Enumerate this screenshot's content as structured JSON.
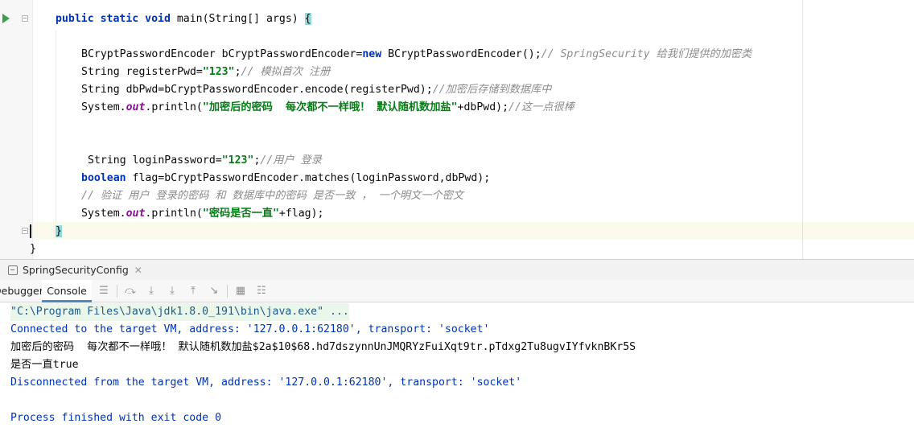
{
  "editor": {
    "lines": [
      {
        "parts": [
          {
            "t": "public static void ",
            "c": "kw"
          },
          {
            "t": "main(String[] args) "
          },
          {
            "t": "{",
            "c": "brace-hl"
          }
        ]
      },
      {
        "parts": [
          {
            "t": "BCryptPasswordEncoder bCryptPasswordEncoder="
          },
          {
            "t": "new",
            "c": "kw"
          },
          {
            "t": " BCryptPasswordEncoder();"
          },
          {
            "t": "// SpringSecurity 给我们提供的加密类",
            "c": "cmt"
          }
        ]
      },
      {
        "parts": [
          {
            "t": "String registerPwd="
          },
          {
            "t": "\"123\"",
            "c": "str"
          },
          {
            "t": ";"
          },
          {
            "t": "// 模拟首次 注册",
            "c": "cmt"
          }
        ]
      },
      {
        "parts": [
          {
            "t": "String dbPwd=bCryptPasswordEncoder.encode(registerPwd);"
          },
          {
            "t": "//加密后存储到数据库中",
            "c": "cmt"
          }
        ]
      },
      {
        "parts": [
          {
            "t": "System."
          },
          {
            "t": "out",
            "c": "fld"
          },
          {
            "t": ".println("
          },
          {
            "t": "\"加密后的密码  每次都不一样哦！ 默认随机数加盐\"",
            "c": "str"
          },
          {
            "t": "+dbPwd);"
          },
          {
            "t": "//这一点很棒",
            "c": "cmt"
          }
        ]
      },
      {
        "parts": [
          {
            "t": "String loginPassword="
          },
          {
            "t": "\"123\"",
            "c": "str"
          },
          {
            "t": ";"
          },
          {
            "t": "//用户 登录",
            "c": "cmt"
          }
        ]
      },
      {
        "parts": [
          {
            "t": "boolean",
            "c": "kw"
          },
          {
            "t": " flag=bCryptPasswordEncoder.matches(loginPassword,dbPwd);"
          }
        ]
      },
      {
        "parts": [
          {
            "t": "// 验证 用户 登录的密码 和 数据库中的密码 是否一致 ， 一个明文一个密文",
            "c": "cmt"
          }
        ]
      },
      {
        "parts": [
          {
            "t": "System."
          },
          {
            "t": "out",
            "c": "fld"
          },
          {
            "t": ".println("
          },
          {
            "t": "\"密码是否一直\"",
            "c": "str"
          },
          {
            "t": "+flag);"
          }
        ]
      },
      {
        "parts": [
          {
            "t": "}",
            "c": "brace-hl"
          }
        ]
      },
      {
        "parts": [
          {
            "t": "}"
          }
        ]
      }
    ]
  },
  "run_panel": {
    "config_tab": "SpringSecurityConfig",
    "debugger_tab": "Debugger",
    "console_tab": "Console"
  },
  "console": {
    "lines": [
      "\"C:\\Program Files\\Java\\jdk1.8.0_191\\bin\\java.exe\" ...",
      "Connected to the target VM, address: '127.0.0.1:62180', transport: 'socket'",
      "加密后的密码  每次都不一样哦！ 默认随机数加盐$2a$10$68.hd7dszynnUnJMQRYzFuiXqt9tr.pTdxg2Tu8ugvIYfvknBKr5S",
      "是否一直true",
      "Disconnected from the target VM, address: '127.0.0.1:62180', transport: 'socket'",
      "Process finished with exit code 0"
    ]
  },
  "colors": {
    "keyword": "#0033b3",
    "string": "#067d17",
    "comment": "#8c8c8c",
    "static_field": "#871094",
    "caret_line": "#fcfaed",
    "console_accent": "#4a88c7"
  },
  "icons": [
    "run-gutter-icon",
    "fold-icon",
    "close-icon",
    "soft-wrap-icon",
    "scroll-to-end-icon",
    "step-over-icon",
    "step-into-icon",
    "step-out-icon",
    "run-to-cursor-icon",
    "evaluate-icon",
    "table-icon"
  ]
}
